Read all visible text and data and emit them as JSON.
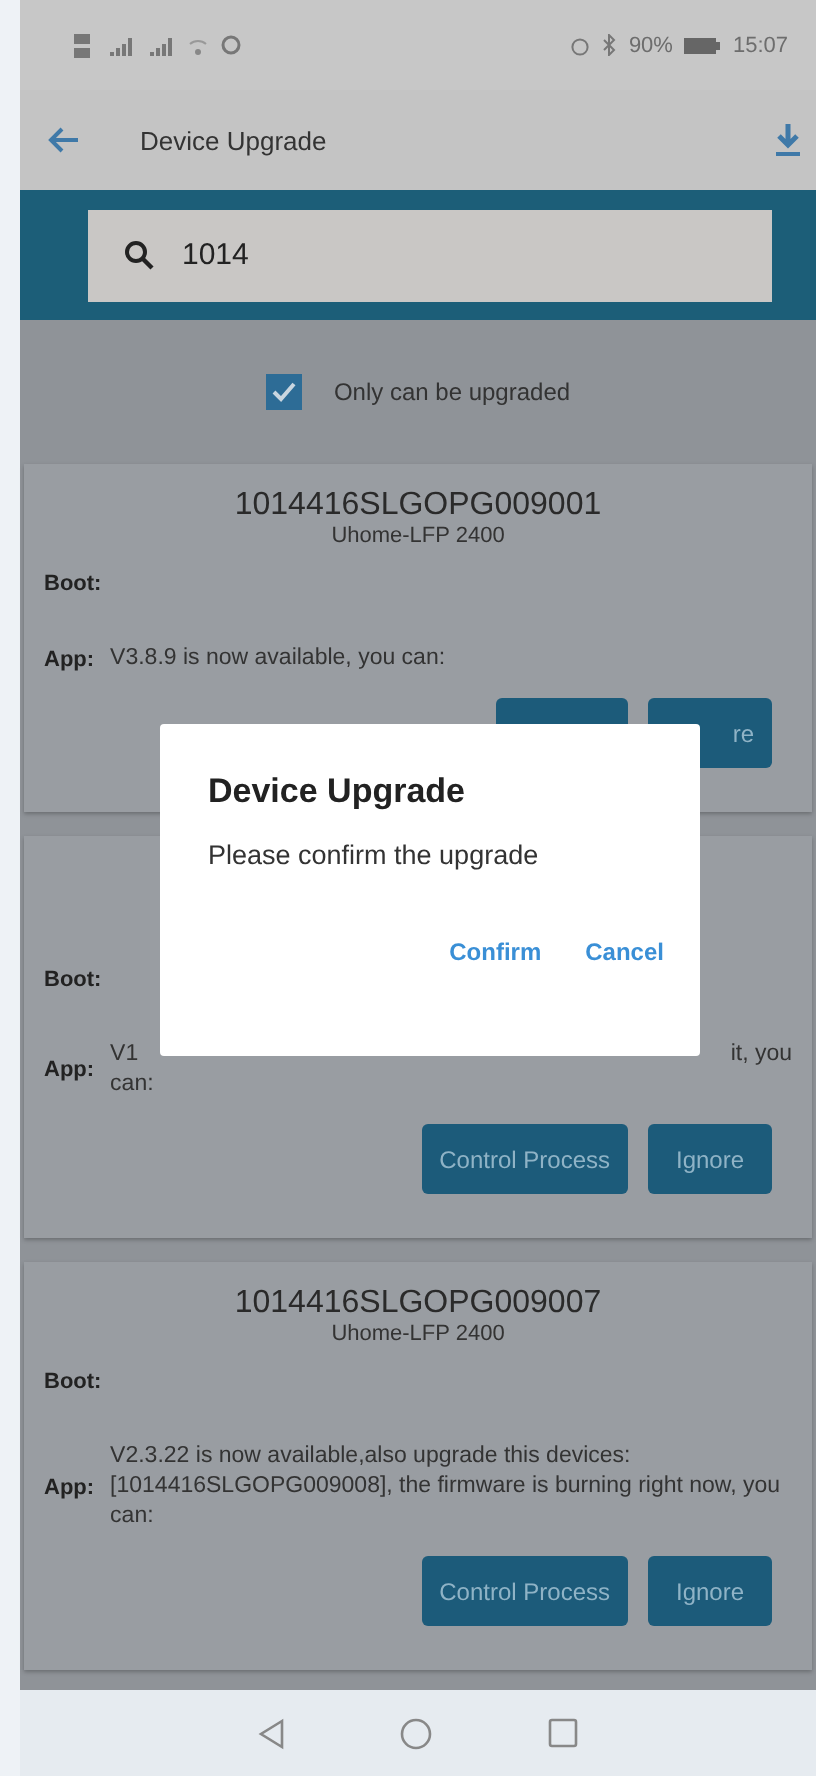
{
  "status_bar": {
    "battery": "90%",
    "time": "15:07"
  },
  "app_bar": {
    "title": "Device Upgrade"
  },
  "search": {
    "value": "1014"
  },
  "filter": {
    "label": "Only can be upgraded",
    "checked": true
  },
  "devices": [
    {
      "serial": "1014416SLGOPG009001",
      "model": "Uhome-LFP 2400",
      "boot_label": "Boot:",
      "app_label": "App:",
      "app_lines": [
        {
          "start": "V3.8.9 is now available, you can:"
        }
      ],
      "buttons": [
        {
          "kind": "hidden"
        },
        {
          "kind": "cut",
          "label": "re"
        }
      ]
    },
    {
      "boot_label": "Boot:",
      "app_label": "App:",
      "app_lines": [
        {
          "start": "V1",
          "end": "it, you"
        },
        {
          "start": "can:"
        }
      ],
      "buttons": [
        {
          "kind": "full",
          "label": "Control Process"
        },
        {
          "kind": "full",
          "label": "Ignore"
        }
      ]
    },
    {
      "serial": "1014416SLGOPG009007",
      "model": "Uhome-LFP 2400",
      "boot_label": "Boot:",
      "app_label": "App:",
      "app_lines": [
        {
          "start": "V2.3.22 is now available,also upgrade this devices: [1014416SLGOPG009008], the firmware is burning right now, you can:"
        }
      ],
      "buttons": [
        {
          "kind": "full",
          "label": "Control Process"
        },
        {
          "kind": "full",
          "label": "Ignore"
        }
      ]
    }
  ],
  "dialog": {
    "title": "Device Upgrade",
    "message": "Please confirm the upgrade",
    "actions": [
      "Confirm",
      "Cancel"
    ]
  }
}
